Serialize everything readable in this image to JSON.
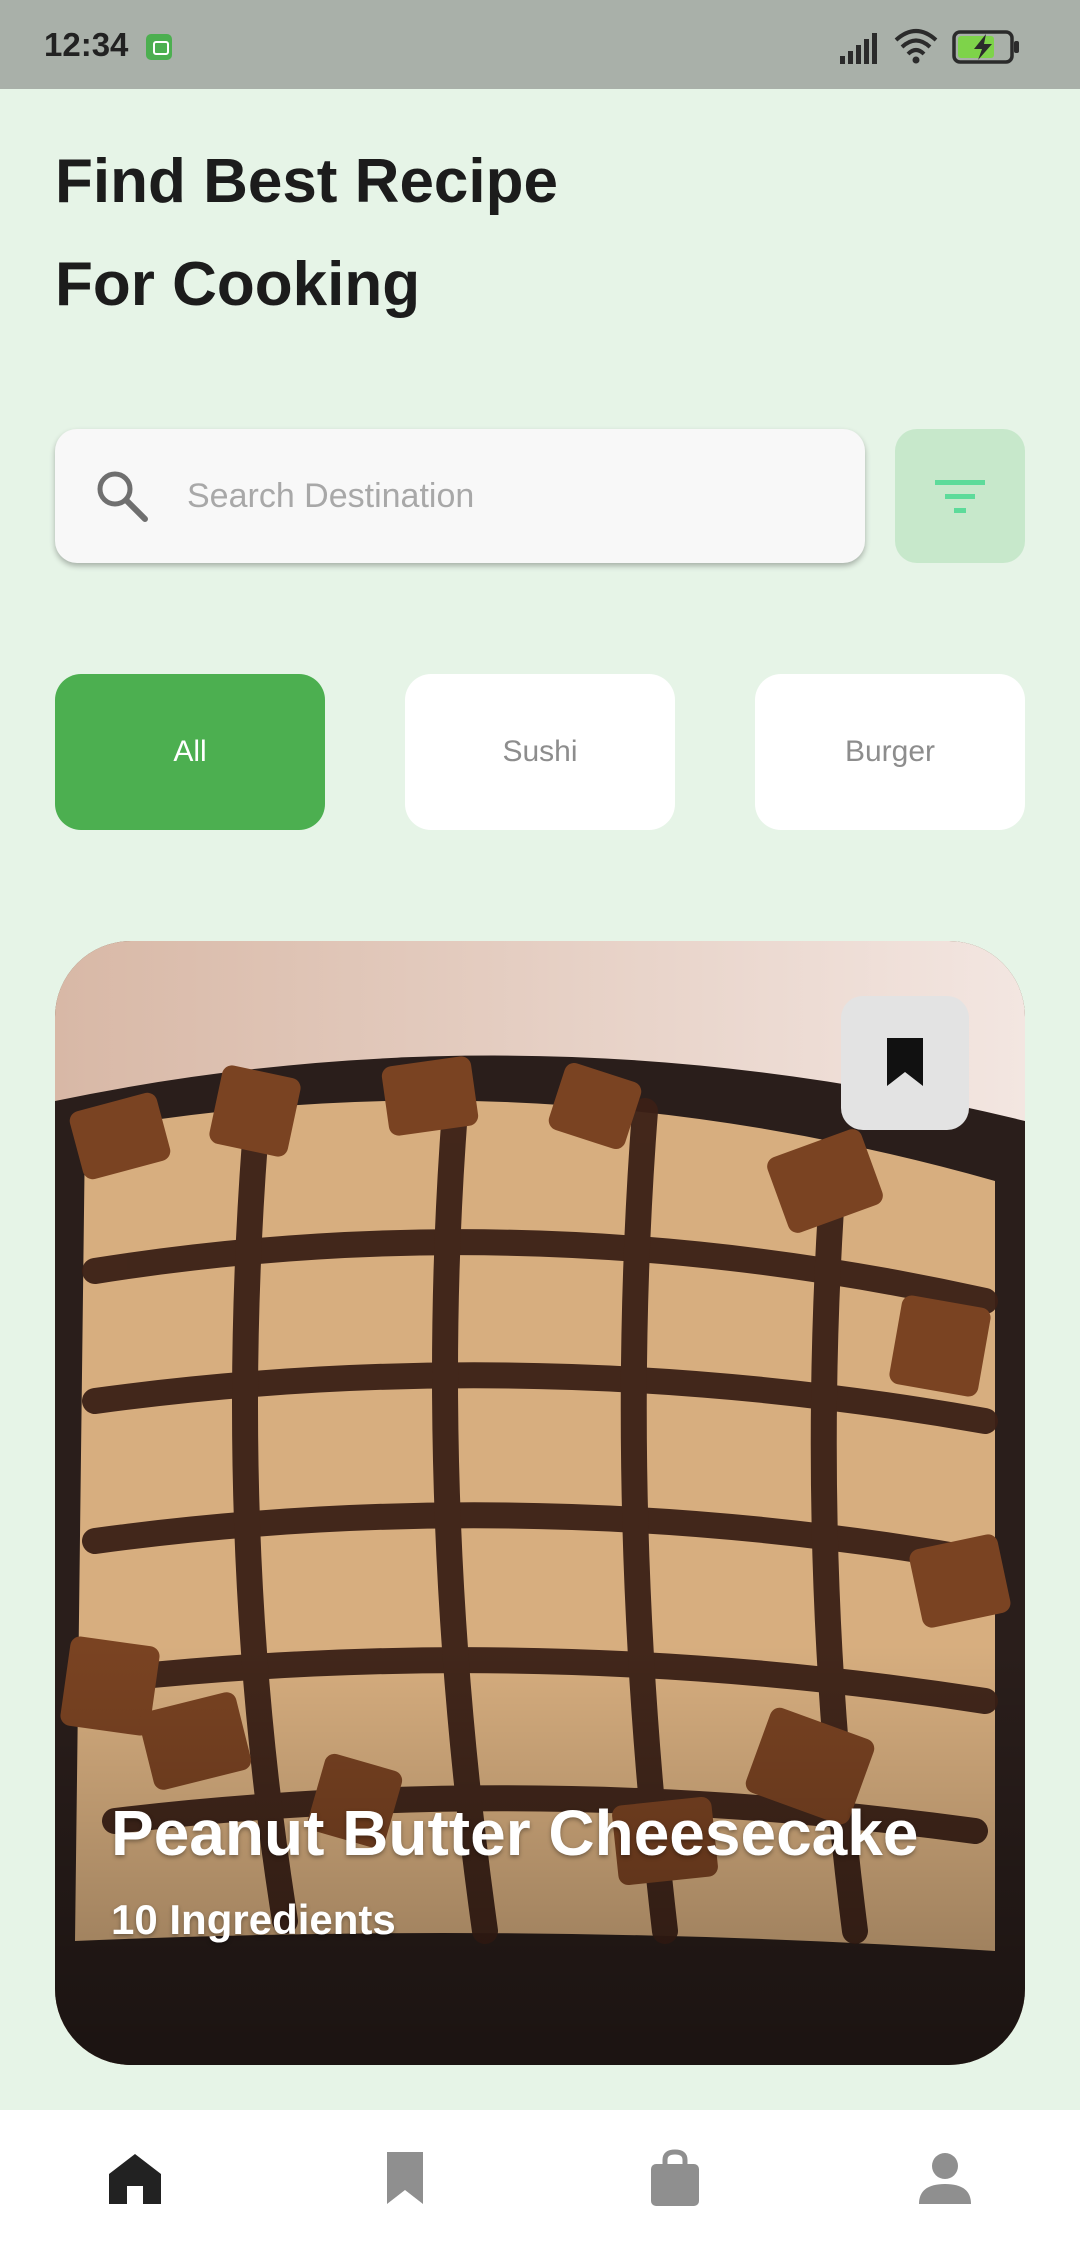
{
  "status_bar": {
    "time": "12:34",
    "icons": [
      "app-notification-icon",
      "signal-icon",
      "wifi-icon",
      "battery-charging-icon"
    ]
  },
  "header": {
    "title_line1": "Find Best Recipe",
    "title_line2": "For Cooking"
  },
  "search": {
    "placeholder": "Search Destination",
    "value": "",
    "icon": "search-icon"
  },
  "filter": {
    "icon": "filter-icon"
  },
  "categories": [
    {
      "label": "All",
      "selected": true
    },
    {
      "label": "Sushi",
      "selected": false
    },
    {
      "label": "Burger",
      "selected": false
    }
  ],
  "recipe_card": {
    "title": "Peanut Butter Cheesecake",
    "subtitle": "10 Ingredients",
    "bookmark_icon": "bookmark-icon"
  },
  "bottom_nav": {
    "items": [
      {
        "icon": "home-icon",
        "active": true
      },
      {
        "icon": "bookmark-icon",
        "active": false
      },
      {
        "icon": "shopping-bag-icon",
        "active": false
      },
      {
        "icon": "profile-icon",
        "active": false
      }
    ]
  },
  "colors": {
    "background": "#e6f4e7",
    "accent": "#4caf50",
    "filter_button": "#c7e8cb",
    "filter_icon": "#5ddb9a",
    "nav_active": "#222222",
    "nav_inactive": "#8f8f8f"
  }
}
